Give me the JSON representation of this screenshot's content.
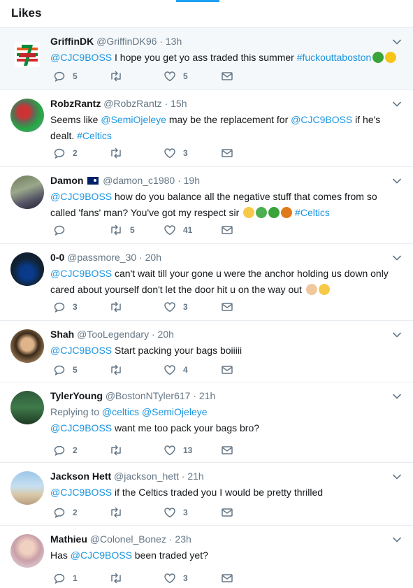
{
  "page": {
    "title": "Likes"
  },
  "tweets": [
    {
      "name": "GriffinDK",
      "handle": "@GriffinDK96",
      "time": "13h",
      "text": [
        {
          "t": "@CJC9BOSS",
          "link": true
        },
        {
          "t": " I hope you get yo ass traded this summer "
        },
        {
          "t": "#fuckouttaboston",
          "link": true
        }
      ],
      "emojis": [
        "shamrock-icon",
        "grin-emoji-icon"
      ],
      "replies": "5",
      "retweets": "",
      "likes": "5",
      "highlighted": true
    },
    {
      "name": "RobzRantz",
      "handle": "@RobzRantz",
      "time": "15h",
      "text": [
        {
          "t": "Seems like "
        },
        {
          "t": "@SemiOjeleye",
          "link": true
        },
        {
          "t": " may be the replacement for "
        },
        {
          "t": "@CJC9BOSS",
          "link": true
        },
        {
          "t": " if he's dealt. "
        },
        {
          "t": "#Celtics",
          "link": true
        }
      ],
      "replies": "2",
      "retweets": "",
      "likes": "3"
    },
    {
      "name": "Damon",
      "handle": "@damon_c1980",
      "time": "19h",
      "flag": true,
      "text": [
        {
          "t": "@CJC9BOSS",
          "link": true
        },
        {
          "t": " how do you balance all the negative stuff that comes from so called 'fans' man? You've got my respect sir "
        }
      ],
      "emojis_after": [
        "victory-hand-icon",
        "green-heart-icon",
        "shamrock-icon",
        "basketball-icon"
      ],
      "tail": [
        {
          "t": " #Celtics",
          "link": true
        }
      ],
      "replies": "",
      "retweets": "5",
      "likes": "41"
    },
    {
      "name": "0-0",
      "handle": "@passmore_30",
      "time": "20h",
      "text": [
        {
          "t": "@CJC9BOSS",
          "link": true
        },
        {
          "t": " can't wait till your gone u were the anchor holding us down only cared about yourself don't let the door hit u on the way out "
        }
      ],
      "emojis_after": [
        "crossed-fingers-icon",
        "victory-hand-icon"
      ],
      "replies": "3",
      "retweets": "",
      "likes": "3"
    },
    {
      "name": "Shah",
      "handle": "@TooLegendary",
      "time": "20h",
      "text": [
        {
          "t": "@CJC9BOSS",
          "link": true
        },
        {
          "t": " Start packing your bags boiiiii"
        }
      ],
      "replies": "5",
      "retweets": "",
      "likes": "4"
    },
    {
      "name": "TylerYoung",
      "handle": "@BostonNTyler617",
      "time": "21h",
      "replying": {
        "label": "Replying to",
        "users": [
          "@celtics",
          "@SemiOjeleye"
        ]
      },
      "text": [
        {
          "t": "@CJC9BOSS",
          "link": true
        },
        {
          "t": " want me too pack your bags bro?"
        }
      ],
      "replies": "2",
      "retweets": "",
      "likes": "13"
    },
    {
      "name": "Jackson Hett",
      "handle": "@jackson_hett",
      "time": "21h",
      "text": [
        {
          "t": "@CJC9BOSS",
          "link": true
        },
        {
          "t": " if the Celtics traded you I would be pretty thrilled"
        }
      ],
      "replies": "2",
      "retweets": "",
      "likes": "3"
    },
    {
      "name": "Mathieu",
      "handle": "@Colonel_Bonez",
      "time": "23h",
      "text": [
        {
          "t": "Has "
        },
        {
          "t": "@CJC9BOSS",
          "link": true
        },
        {
          "t": " been traded yet?"
        }
      ],
      "replies": "1",
      "retweets": "",
      "likes": "3"
    }
  ],
  "colors": {
    "accent": "#1b95e0",
    "muted": "#657786",
    "border": "#e6ecf0",
    "highlight": "#f5f8fa"
  }
}
